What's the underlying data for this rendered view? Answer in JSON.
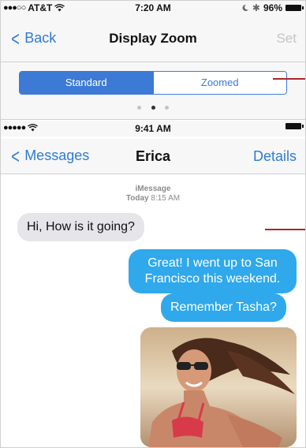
{
  "top_screen": {
    "status": {
      "carrier": "AT&T",
      "time": "7:20 AM",
      "battery": "96%"
    },
    "nav": {
      "back_label": "Back",
      "title": "Display Zoom",
      "right_label": "Set"
    },
    "segmented": {
      "standard_label": "Standard",
      "zoomed_label": "Zoomed",
      "selected": "Standard"
    },
    "page_indicator": {
      "count": 3,
      "current": 2
    }
  },
  "bottom_screen": {
    "status": {
      "time": "9:41 AM"
    },
    "nav": {
      "back_label": "Messages",
      "title": "Erica",
      "right_label": "Details"
    },
    "chat_header": {
      "service": "iMessage",
      "day": "Today",
      "time": "8:15 AM"
    },
    "messages": [
      {
        "direction": "incoming",
        "text": "Hi, How is it going?"
      },
      {
        "direction": "outgoing",
        "text": "Great! I went up to San Francisco this weekend."
      },
      {
        "direction": "outgoing",
        "text": "Remember Tasha?"
      },
      {
        "direction": "outgoing",
        "type": "photo"
      }
    ]
  },
  "colors": {
    "accent": "#3d7ad6",
    "link": "#2f7bd8",
    "outgoing_bubble": "#2fa9ec",
    "incoming_bubble": "#e5e5ea",
    "callout": "#b0222b"
  }
}
